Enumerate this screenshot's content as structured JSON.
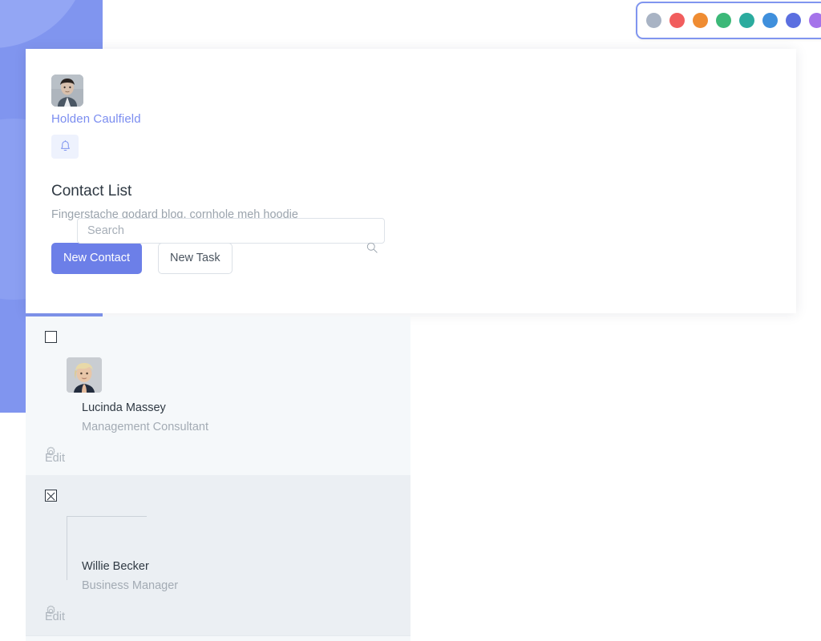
{
  "palette": {
    "name": "color-palette-toolbar",
    "swatches": [
      {
        "name": "gray",
        "hex": "#a8b3c4"
      },
      {
        "name": "red",
        "hex": "#f15d5d"
      },
      {
        "name": "orange",
        "hex": "#ef8c32"
      },
      {
        "name": "green",
        "hex": "#3cb878"
      },
      {
        "name": "teal",
        "hex": "#2bab9e"
      },
      {
        "name": "blue",
        "hex": "#3f8fdc"
      },
      {
        "name": "indigo",
        "hex": "#5b6fe0"
      },
      {
        "name": "purple",
        "hex": "#a573ea"
      },
      {
        "name": "pink",
        "hex": "#ef5fa7"
      }
    ]
  },
  "background": {
    "block_color": "#8095ef",
    "circle_1_color": "#93a6f4",
    "circle_2_color": "#8b9ff2"
  },
  "header": {
    "user_name": "Holden Caulfield",
    "avatar_icon": "user-photo",
    "notification_icon": "bell-icon",
    "title": "Contact List",
    "subtitle": "Fingerstache godard blog, cornhole meh hoodie",
    "primary_button": "New Contact",
    "secondary_button": "New Task",
    "accent_color": "#6c7fe8"
  },
  "search": {
    "placeholder": "Search",
    "value": "",
    "icon": "search-icon"
  },
  "contacts": [
    {
      "checked": false,
      "avatar_icon": "woman-photo",
      "name": "Lucinda Massey",
      "title": "Management Consultant",
      "action_label": "Edit",
      "action_icon": "gear-icon",
      "row_background": "#f5f8fa"
    },
    {
      "checked": true,
      "avatar_icon": "broken-image",
      "name": "Willie Becker",
      "title": "Business Manager",
      "action_label": "Edit",
      "action_icon": "gear-icon",
      "row_background": "#ebeff3"
    }
  ]
}
